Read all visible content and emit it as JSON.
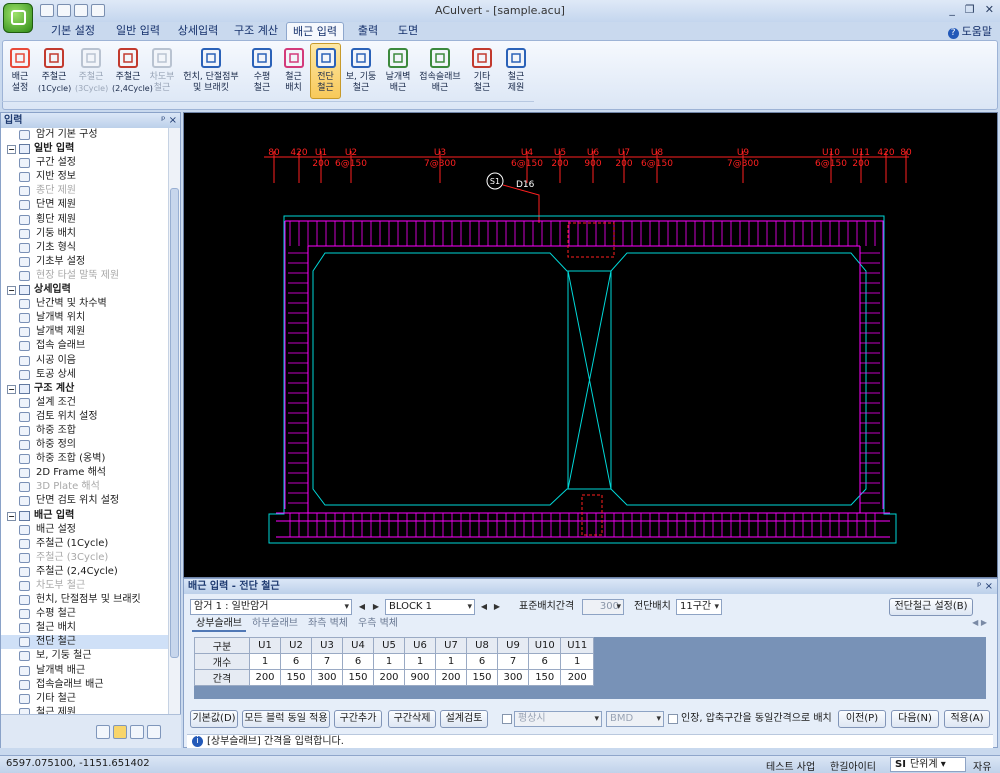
{
  "window": {
    "title": "ACulvert - [sample.acu]",
    "controls": [
      "_",
      "❐",
      "✕"
    ]
  },
  "tabs": [
    "기본 설정",
    "일반 입력",
    "상세입력",
    "구조 계산",
    "배근 입력",
    "출력",
    "도면"
  ],
  "help": "도움말",
  "ribbon": [
    {
      "label": "배근\n설정",
      "sub": "",
      "state": "normal"
    },
    {
      "label": "주철근",
      "sub": "(1Cycle)",
      "state": "normal"
    },
    {
      "label": "주철근",
      "sub": "(3Cycle)",
      "state": "disabled"
    },
    {
      "label": "주철근",
      "sub": "(2,4Cycle)",
      "state": "normal"
    },
    {
      "label": "차도부\n철근",
      "sub": "",
      "state": "disabled"
    },
    {
      "label": "헌치, 단절점부\n및 브래킷",
      "sub": "",
      "state": "normal"
    },
    {
      "label": "수평\n철근",
      "sub": "",
      "state": "normal"
    },
    {
      "label": "철근\n배치",
      "sub": "",
      "state": "normal"
    },
    {
      "label": "전단\n철근",
      "sub": "",
      "state": "active"
    },
    {
      "label": "보, 기둥\n철근",
      "sub": "",
      "state": "normal"
    },
    {
      "label": "날개벽\n배근",
      "sub": "",
      "state": "normal"
    },
    {
      "label": "접속슬래브\n배근",
      "sub": "",
      "state": "normal"
    },
    {
      "label": "기타\n철근",
      "sub": "",
      "state": "normal"
    },
    {
      "label": "철근\n제원",
      "sub": "",
      "state": "normal"
    }
  ],
  "panel": {
    "title": "입력",
    "pin": "ᵖ ×"
  },
  "tree": [
    {
      "t": "암거 기본 구성",
      "k": "item"
    },
    {
      "t": "일반 입력",
      "k": "grp"
    },
    {
      "t": "구간 설정",
      "k": "item"
    },
    {
      "t": "지반 정보",
      "k": "item"
    },
    {
      "t": "종단 제원",
      "k": "dis"
    },
    {
      "t": "단면 제원",
      "k": "item"
    },
    {
      "t": "횡단 제원",
      "k": "item"
    },
    {
      "t": "기둥 배치",
      "k": "item"
    },
    {
      "t": "기초 형식",
      "k": "item"
    },
    {
      "t": "기초부 설정",
      "k": "item"
    },
    {
      "t": "현장 타설 말뚝 제원",
      "k": "dis"
    },
    {
      "t": "상세입력",
      "k": "grp"
    },
    {
      "t": "난간벽 및 차수벽",
      "k": "item"
    },
    {
      "t": "날개벽 위치",
      "k": "item"
    },
    {
      "t": "날개벽 제원",
      "k": "item"
    },
    {
      "t": "접속 슬래브",
      "k": "item"
    },
    {
      "t": "시공 이음",
      "k": "item"
    },
    {
      "t": "토공 상세",
      "k": "item"
    },
    {
      "t": "구조 계산",
      "k": "grp"
    },
    {
      "t": "설계 조건",
      "k": "item"
    },
    {
      "t": "검토 위치 설정",
      "k": "item"
    },
    {
      "t": "하중 조합",
      "k": "item"
    },
    {
      "t": "하중 정의",
      "k": "item"
    },
    {
      "t": "하중 조합 (옹벽)",
      "k": "item"
    },
    {
      "t": "2D Frame 해석",
      "k": "item"
    },
    {
      "t": "3D Plate 해석",
      "k": "dis"
    },
    {
      "t": "단면 검토 위치 설정",
      "k": "item"
    },
    {
      "t": "배근 입력",
      "k": "grp"
    },
    {
      "t": "배근 설정",
      "k": "item"
    },
    {
      "t": "주철근 (1Cycle)",
      "k": "item"
    },
    {
      "t": "주철근 (3Cycle)",
      "k": "dis"
    },
    {
      "t": "주철근 (2,4Cycle)",
      "k": "item"
    },
    {
      "t": "차도부 철근",
      "k": "dis"
    },
    {
      "t": "헌치, 단절점부 및 브래킷",
      "k": "item"
    },
    {
      "t": "수평 철근",
      "k": "item"
    },
    {
      "t": "철근 배치",
      "k": "item"
    },
    {
      "t": "전단 철근",
      "k": "sel"
    },
    {
      "t": "보, 기둥 철근",
      "k": "item"
    },
    {
      "t": "날개벽 배근",
      "k": "item"
    },
    {
      "t": "접속슬래브 배근",
      "k": "item"
    },
    {
      "t": "기타 철근",
      "k": "item"
    },
    {
      "t": "철근 제원",
      "k": "item"
    }
  ],
  "drawing": {
    "top_dims": [
      "80",
      "420",
      "U1",
      "U2",
      "U3",
      "U4",
      "U5",
      "U6",
      "U7",
      "U8",
      "U9",
      "U10",
      "U11",
      "420",
      "80"
    ],
    "sub_dims": [
      "200",
      "6@150",
      "7@300",
      "6@150",
      "200",
      "900",
      "200",
      "6@150",
      "7@300",
      "6@150",
      "200"
    ],
    "marker": "S1",
    "bar": "D16",
    "colors": {
      "dim": "#ff2020",
      "outline": "#00d8d8",
      "rebar": "#ff00ff",
      "marker": "#ffffff"
    }
  },
  "bottom": {
    "title": "배근 입력 - 전단 철근",
    "pin": "ᵖ ×",
    "culvert_select": "암거 1 : 일반암거",
    "block_select": "BLOCK  1",
    "std_spacing_label": "표준배치간격",
    "std_spacing_value": "300",
    "shear_layout_label": "전단배치",
    "shear_layout_value": "11구간",
    "setting_button": "전단철근 설정(B)",
    "inner_tabs": [
      "상부슬래브",
      "하부슬래브",
      "좌측 벽체",
      "우측 벽체"
    ],
    "table": {
      "headers": [
        "구분",
        "U1",
        "U2",
        "U3",
        "U4",
        "U5",
        "U6",
        "U7",
        "U8",
        "U9",
        "U10",
        "U11"
      ],
      "rows": [
        {
          "name": "개수",
          "vals": [
            "1",
            "6",
            "7",
            "6",
            "1",
            "1",
            "1",
            "6",
            "7",
            "6",
            "1"
          ]
        },
        {
          "name": "간격",
          "vals": [
            "200",
            "150",
            "300",
            "150",
            "200",
            "900",
            "200",
            "150",
            "300",
            "150",
            "200"
          ]
        }
      ]
    },
    "buttons": [
      "기본값(D)",
      "모든 블럭 동일 적용",
      "구간추가",
      "구간삭제",
      "설계검토"
    ],
    "combo1": "평상시",
    "combo2": "BMD",
    "checkbox_label": "인장, 압축구간을 동일간격으로 배치",
    "nav_buttons": [
      "이전(P)",
      "다음(N)",
      "적용(A)"
    ],
    "info": "[상부슬래브] 간격을 입력합니다."
  },
  "status": {
    "coords": "6597.075100,   -1151.651402",
    "items": [
      "테스트 사업",
      "한길아이티"
    ],
    "unit_prefix": "SI",
    "unit_label": "단위계",
    "mode": "자유"
  }
}
